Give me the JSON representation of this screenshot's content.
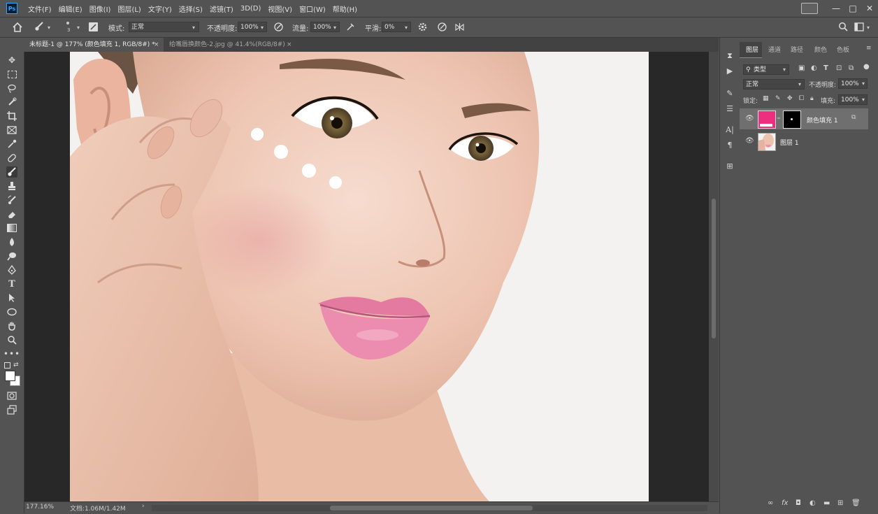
{
  "app": {
    "logo_text": "Ps"
  },
  "menu": [
    "文件(F)",
    "编辑(E)",
    "图像(I)",
    "图层(L)",
    "文字(Y)",
    "选择(S)",
    "滤镜(T)",
    "3D(D)",
    "视图(V)",
    "窗口(W)",
    "帮助(H)"
  ],
  "window_controls": {
    "minimize": "—",
    "restore": "□",
    "close": "✕"
  },
  "options": {
    "brush_size": "3",
    "mode_label": "模式:",
    "mode_value": "正常",
    "opacity_label": "不透明度:",
    "opacity_value": "100%",
    "flow_label": "流量:",
    "flow_value": "100%",
    "smoothing_label": "平滑:",
    "smoothing_value": "0%"
  },
  "tabs": [
    {
      "label": "未标题-1 @ 177% (颜色填充 1, RGB/8#) *",
      "close": "×"
    },
    {
      "label": "给嘴唇换颜色-2.jpg @ 41.4%(RGB/8#)",
      "close": "×"
    }
  ],
  "status": {
    "zoom": "177.16%",
    "doc_info": "文档:1.06M/1.42M",
    "arrow": "›"
  },
  "layers_panel": {
    "tabs": [
      "图层",
      "通道",
      "路径",
      "颜色",
      "色板"
    ],
    "filter_label": "类型",
    "blend_mode": "正常",
    "opacity_label": "不透明度:",
    "opacity_value": "100%",
    "lock_label": "锁定:",
    "fill_label": "填充:",
    "fill_value": "100%",
    "layers": [
      {
        "name": "颜色填充 1",
        "fill_color": "#ee2e7f",
        "selected": true
      },
      {
        "name": "图层 1",
        "selected": false
      }
    ]
  },
  "colors": {
    "ui_bg": "#535353",
    "canvas_bg": "#282828",
    "fill_layer_pink": "#ee2e7f"
  }
}
